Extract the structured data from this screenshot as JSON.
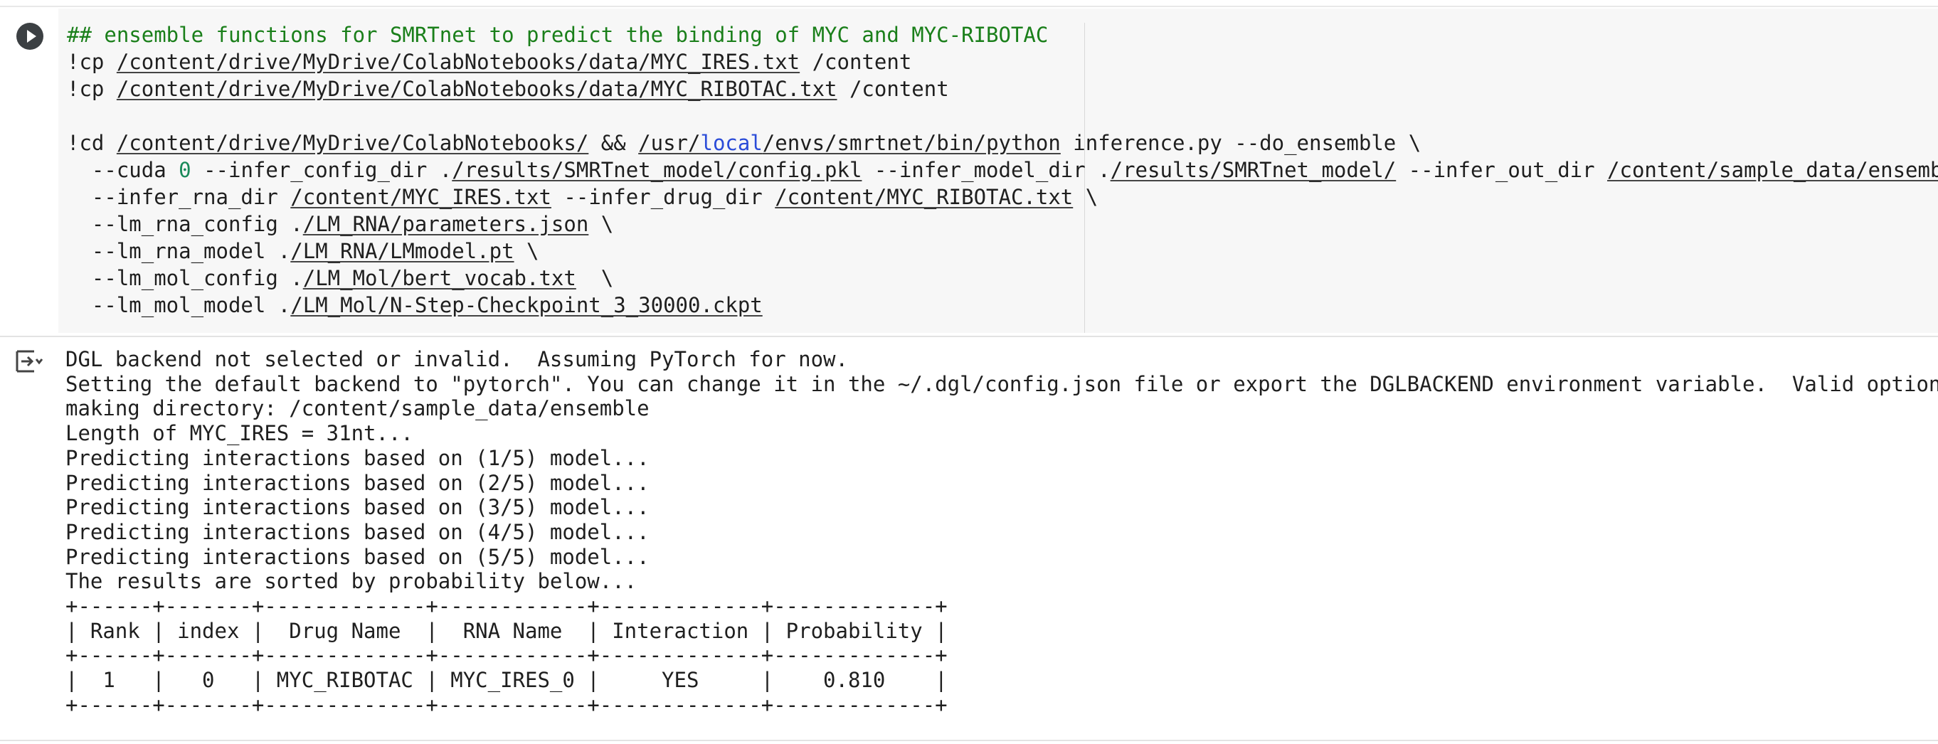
{
  "code_cell": {
    "comment": "## ensemble functions for SMRTnet to predict the binding of MYC and MYC-RIBOTAC",
    "cp1": {
      "bang": "!",
      "cmd": "cp ",
      "src": "/content/drive/MyDrive/ColabNotebooks/data/MYC_IRES.txt",
      "dst": " /content"
    },
    "cp2": {
      "bang": "!",
      "cmd": "cp ",
      "src": "/content/drive/MyDrive/ColabNotebooks/data/MYC_RIBOTAC.txt",
      "dst": " /content"
    },
    "cd": {
      "bang": "!",
      "cmd": "cd ",
      "dir": "/content/drive/MyDrive/ColabNotebooks/",
      "and": " && ",
      "py_a": "/usr/",
      "py_kw": "local",
      "py_b": "/envs/smrtnet/bin/python",
      "rest": " inference.py --do_ensemble \\"
    },
    "l2": {
      "a": "  --cuda ",
      "num": "0",
      "b": " --infer_config_dir .",
      "p1": "/results/SMRTnet_model/config.pkl",
      "c": " --infer_model_dir .",
      "p2": "/results/SMRTnet_model/",
      "d": " --infer_out_dir ",
      "p3": "/content/sample_data/ensemble",
      "e": " \\"
    },
    "l3": {
      "a": "  --infer_rna_dir ",
      "p1": "/content/MYC_IRES.txt",
      "b": " --infer_drug_dir ",
      "p2": "/content/MYC_RIBOTAC.txt",
      "c": " \\"
    },
    "l4": {
      "a": "  --lm_rna_config .",
      "p": "/LM_RNA/parameters.json",
      "b": " \\"
    },
    "l5": {
      "a": "  --lm_rna_model .",
      "p": "/LM_RNA/LMmodel.pt",
      "b": " \\"
    },
    "l6": {
      "a": "  --lm_mol_config .",
      "p": "/LM_Mol/bert_vocab.txt",
      "b": "  \\"
    },
    "l7": {
      "a": "  --lm_mol_model .",
      "p": "/LM_Mol/N-Step-Checkpoint_3_30000.ckpt",
      "b": ""
    }
  },
  "output_cell": {
    "lines": [
      "DGL backend not selected or invalid.  Assuming PyTorch for now.",
      "Setting the default backend to \"pytorch\". You can change it in the ~/.dgl/config.json file or export the DGLBACKEND environment variable.  Valid options are",
      "making directory: /content/sample_data/ensemble",
      "Length of MYC_IRES = 31nt...",
      "Predicting interactions based on (1/5) model...",
      "Predicting interactions based on (2/5) model...",
      "Predicting interactions based on (3/5) model...",
      "Predicting interactions based on (4/5) model...",
      "Predicting interactions based on (5/5) model...",
      "The results are sorted by probability below...",
      "+------+-------+-------------+------------+-------------+-------------+",
      "| Rank | index |  Drug Name  |  RNA Name  | Interaction | Probability |",
      "+------+-------+-------------+------------+-------------+-------------+",
      "|  1   |   0   | MYC_RIBOTAC | MYC_IRES_0 |     YES     |    0.810    |",
      "+------+-------+-------------+------------+-------------+-------------+"
    ]
  },
  "icons": {
    "run": "play-circle-icon",
    "output": "output-menu-icon"
  },
  "colors": {
    "comment": "#1a7f1a",
    "keyword": "#2b4cd8",
    "number": "#1a8a5a",
    "editor_bg": "#f7f7f7"
  }
}
